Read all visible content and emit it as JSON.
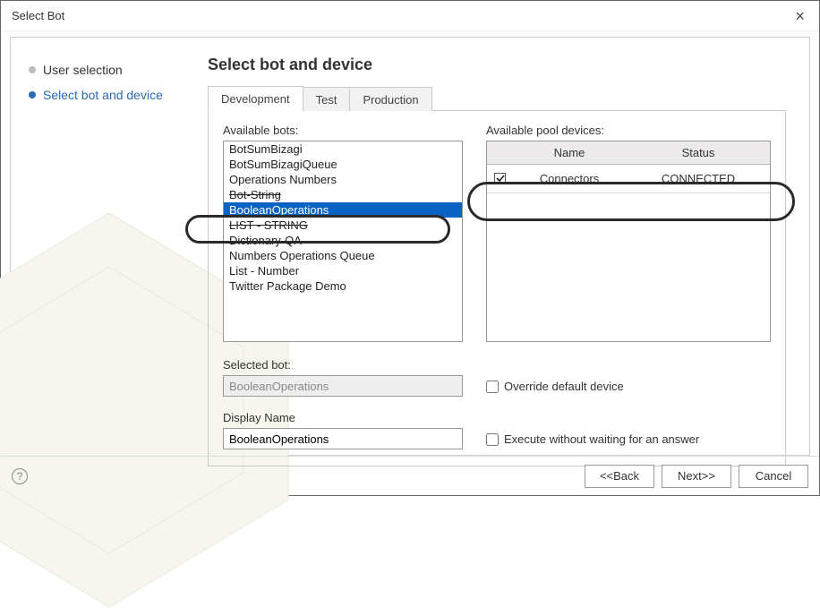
{
  "window": {
    "title": "Select Bot"
  },
  "sidebar": {
    "steps": [
      {
        "label": "User selection",
        "active": false
      },
      {
        "label": "Select bot and device",
        "active": true
      }
    ]
  },
  "main": {
    "heading": "Select bot and device",
    "tabs": [
      {
        "label": "Development",
        "active": true
      },
      {
        "label": "Test",
        "active": false
      },
      {
        "label": "Production",
        "active": false
      }
    ],
    "available_bots_label": "Available bots:",
    "bots": [
      {
        "label": "BotSumBizagi",
        "selected": false
      },
      {
        "label": "BotSumBizagiQueue",
        "selected": false
      },
      {
        "label": "Operations Numbers",
        "selected": false
      },
      {
        "label": "Bot-String",
        "selected": false,
        "strike": true
      },
      {
        "label": "BooleanOperations",
        "selected": true
      },
      {
        "label": "LIST - STRING",
        "selected": false,
        "strike": true
      },
      {
        "label": "Dictionary-QA",
        "selected": false
      },
      {
        "label": "Numbers Operations Queue",
        "selected": false
      },
      {
        "label": "List - Number",
        "selected": false
      },
      {
        "label": "Twitter Package Demo",
        "selected": false
      }
    ],
    "available_devices_label": "Available pool devices:",
    "device_headers": {
      "name": "Name",
      "status": "Status"
    },
    "devices": [
      {
        "checked": true,
        "name": "Connectors",
        "status": "CONNECTED"
      }
    ],
    "selected_bot_label": "Selected bot:",
    "selected_bot_value": "BooleanOperations",
    "override_label": "Override default device",
    "override_checked": false,
    "display_name_label": "Display Name",
    "display_name_value": "BooleanOperations",
    "execute_label": "Execute without waiting for an answer",
    "execute_checked": false
  },
  "footer": {
    "back": "<<Back",
    "next": "Next>>",
    "cancel": "Cancel"
  }
}
